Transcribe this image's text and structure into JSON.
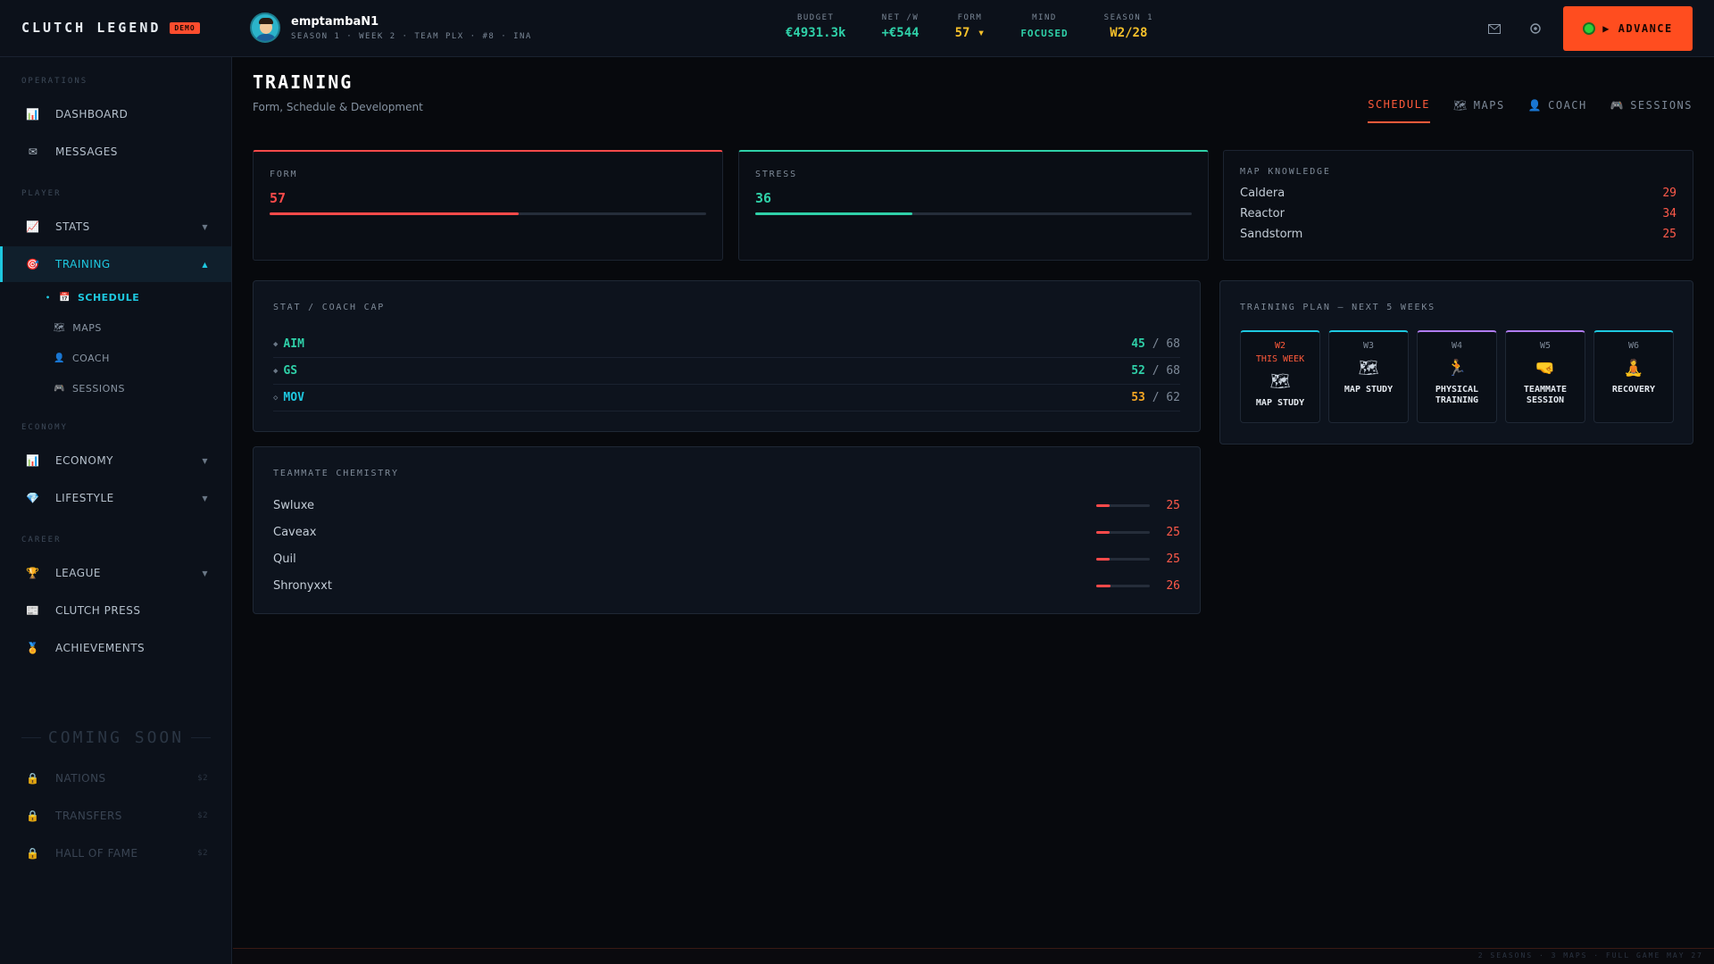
{
  "brand": {
    "name": "CLUTCH LEGEND",
    "badge": "DEMO"
  },
  "user": {
    "name": "emptambaN1",
    "subtitle": "SEASON 1 · WEEK 2 · TEAM PLX · #8 · INA"
  },
  "top_stats": [
    {
      "label": "BUDGET",
      "value": "€4931.3k",
      "color": "#2fd0a8"
    },
    {
      "label": "NET /W",
      "value": "+€544",
      "color": "#2fd0a8"
    },
    {
      "label": "FORM",
      "value": "57 ▾",
      "color": "#f5c02a"
    },
    {
      "label": "MIND",
      "value": "FOCUSED",
      "color": "#2fd0a8"
    },
    {
      "label": "SEASON 1",
      "value": "W2/28",
      "color": "#f5c02a"
    }
  ],
  "advance": {
    "label": "▶ ADVANCE"
  },
  "icons": {
    "mail": "mail-icon",
    "settings": "settings-icon"
  },
  "sidebar": {
    "sections": {
      "operations": "OPERATIONS",
      "player": "PLAYER",
      "economy": "ECONOMY",
      "career": "CAREER"
    },
    "items": {
      "dashboard": {
        "label": "DASHBOARD",
        "icon": "📊"
      },
      "messages": {
        "label": "MESSAGES",
        "icon": "✉"
      },
      "stats": {
        "label": "STATS",
        "icon": "📈"
      },
      "training": {
        "label": "TRAINING",
        "icon": "🎯"
      },
      "economy": {
        "label": "ECONOMY",
        "icon": "📊"
      },
      "lifestyle": {
        "label": "LIFESTYLE",
        "icon": "💎"
      },
      "league": {
        "label": "LEAGUE",
        "icon": "🏆"
      },
      "press": {
        "label": "CLUTCH PRESS",
        "icon": "📰"
      },
      "achievements": {
        "label": "ACHIEVEMENTS",
        "icon": "🏅"
      }
    },
    "training_sub": {
      "schedule": {
        "label": "SCHEDULE",
        "icon": "📅"
      },
      "maps": {
        "label": "MAPS",
        "icon": "🗺"
      },
      "coach": {
        "label": "COACH",
        "icon": "👤"
      },
      "sessions": {
        "label": "SESSIONS",
        "icon": "🎮"
      }
    },
    "coming_soon": "COMING SOON",
    "locked": [
      {
        "label": "NATIONS",
        "price": "$2"
      },
      {
        "label": "TRANSFERS",
        "price": "$2"
      },
      {
        "label": "HALL OF FAME",
        "price": "$2"
      }
    ]
  },
  "page": {
    "title": "TRAINING",
    "subtitle": "Form, Schedule & Development"
  },
  "tabs": [
    {
      "label": "SCHEDULE",
      "icon": "",
      "active": true
    },
    {
      "label": "MAPS",
      "icon": "🗺"
    },
    {
      "label": "COACH",
      "icon": "👤"
    },
    {
      "label": "SESSIONS",
      "icon": "🎮"
    }
  ],
  "form_card": {
    "label": "FORM",
    "value": "57",
    "level": 0.57,
    "color": "#ff4a4a"
  },
  "stress_card": {
    "label": "STRESS",
    "value": "36",
    "level": 0.36,
    "color": "#2fd0a8"
  },
  "map_knowledge": {
    "label": "MAP KNOWLEDGE",
    "maps": [
      {
        "name": "Caldera",
        "value": "29"
      },
      {
        "name": "Reactor",
        "value": "34"
      },
      {
        "name": "Sandstorm",
        "value": "25"
      }
    ]
  },
  "stat_cap": {
    "label": "STAT / COACH CAP",
    "rows": [
      {
        "marker": "◆",
        "name": "AIM",
        "value": "45",
        "cap": "/ 68",
        "color": "#2fd0a8"
      },
      {
        "marker": "◆",
        "name": "GS",
        "value": "52",
        "cap": "/ 68",
        "color": "#2fd0a8"
      },
      {
        "marker": "◇",
        "name": "MOV",
        "value": "53",
        "cap": "/ 62",
        "color": "#f5a623",
        "name_color": "#1ec8e0"
      }
    ]
  },
  "chemistry": {
    "label": "TEAMMATE CHEMISTRY",
    "rows": [
      {
        "name": "Swluxe",
        "value": "25",
        "level": 0.25
      },
      {
        "name": "Caveax",
        "value": "25",
        "level": 0.25
      },
      {
        "name": "Quil",
        "value": "25",
        "level": 0.25
      },
      {
        "name": "Shronyxxt",
        "value": "26",
        "level": 0.26
      }
    ]
  },
  "training_plan": {
    "label": "TRAINING PLAN — NEXT 5 WEEKS",
    "weeks": [
      {
        "week": "W2",
        "tag": "THIS WEEK",
        "icon": "🗺",
        "activity": "MAP STUDY",
        "accent": "#1ec8e0"
      },
      {
        "week": "W3",
        "tag": "",
        "icon": "🗺",
        "activity": "MAP STUDY",
        "accent": "#1ec8e0"
      },
      {
        "week": "W4",
        "tag": "",
        "icon": "🏃",
        "activity": "PHYSICAL TRAINING",
        "accent": "#b07cf0"
      },
      {
        "week": "W5",
        "tag": "",
        "icon": "🤜",
        "activity": "TEAMMATE SESSION",
        "accent": "#b07cf0"
      },
      {
        "week": "W6",
        "tag": "",
        "icon": "🧘",
        "activity": "RECOVERY",
        "accent": "#1ec8e0"
      }
    ]
  },
  "footer": {
    "text": "2 SEASONS · 3 MAPS · FULL GAME MAY 27"
  }
}
